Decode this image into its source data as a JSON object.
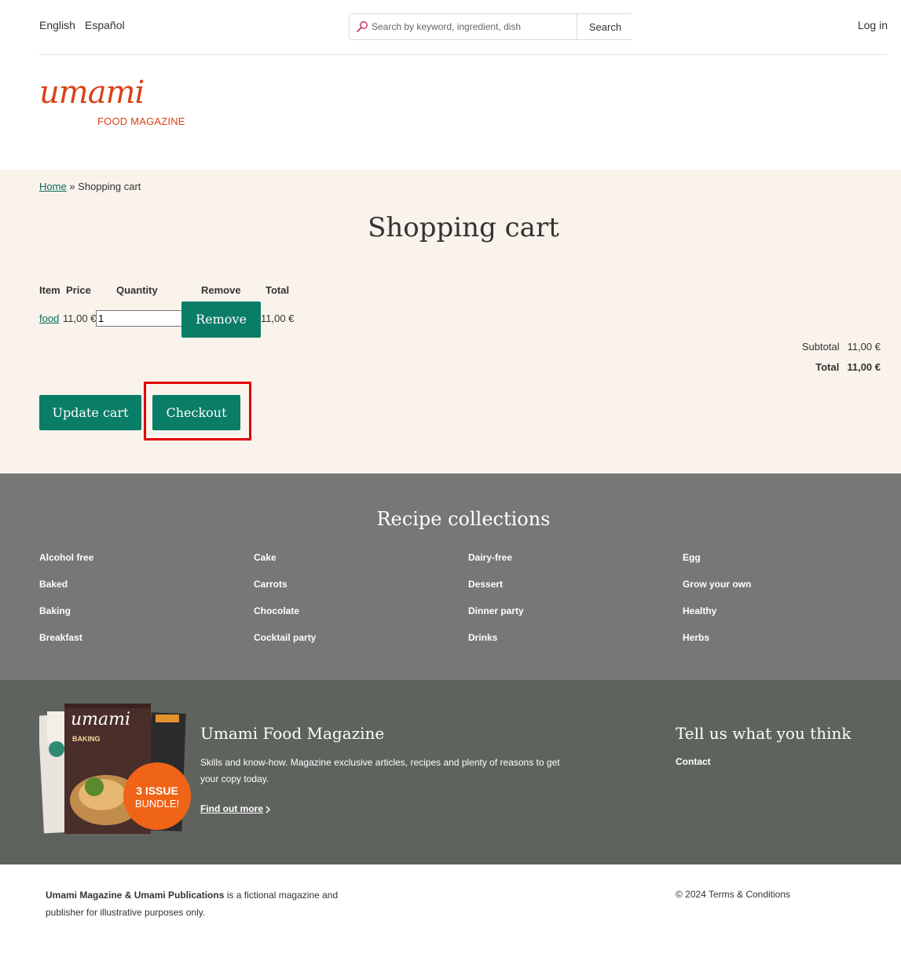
{
  "header": {
    "languages": [
      "English",
      "Español"
    ],
    "search": {
      "placeholder": "Search by keyword, ingredient, dish",
      "button_label": "Search"
    },
    "login_label": "Log in"
  },
  "logo": {
    "script_text": "umami",
    "subtitle": "FOOD MAGAZINE"
  },
  "breadcrumb": {
    "home": "Home",
    "separator": "»",
    "current": "Shopping cart"
  },
  "cart": {
    "title": "Shopping cart",
    "columns": [
      "Item",
      "Price",
      "Quantity",
      "Remove",
      "Total"
    ],
    "items": [
      {
        "name": "food",
        "price": "11,00 €",
        "quantity": "1",
        "remove_label": "Remove",
        "total": "11,00 €"
      }
    ],
    "subtotal_label": "Subtotal",
    "subtotal_value": "11,00 €",
    "total_label": "Total",
    "total_value": "11,00 €",
    "update_label": "Update cart",
    "checkout_label": "Checkout"
  },
  "collections": {
    "title": "Recipe collections",
    "columns": [
      [
        "Alcohol free",
        "Baked",
        "Baking",
        "Breakfast"
      ],
      [
        "Cake",
        "Carrots",
        "Chocolate",
        "Cocktail party"
      ],
      [
        "Dairy-free",
        "Dessert",
        "Dinner party",
        "Drinks"
      ],
      [
        "Egg",
        "Grow your own",
        "Healthy",
        "Herbs"
      ]
    ]
  },
  "promo": {
    "title": "Umami Food Magazine",
    "text": "Skills and know-how. Magazine exclusive articles, recipes and plenty of reasons to get your copy today.",
    "link_label": "Find out more",
    "badge_line1": "3 ISSUE",
    "badge_line2": "BUNDLE!",
    "cover_title": "umami",
    "cover_subtitle": "BAKING",
    "feedback_title": "Tell us what you think",
    "contact_label": "Contact"
  },
  "footer": {
    "brand": "Umami Magazine & Umami Publications",
    "text": " is a fictional magazine and publisher for illustrative purposes only.",
    "copyright": "© 2024 Terms & Conditions"
  },
  "colors": {
    "brand_orange": "#d9421b",
    "button_green": "#0a7d66",
    "link_green": "#0a6b57",
    "cart_bg": "#faf3ec",
    "collections_bg": "#777776",
    "promo_bg": "#5f635e",
    "highlight_red": "#e00000"
  }
}
